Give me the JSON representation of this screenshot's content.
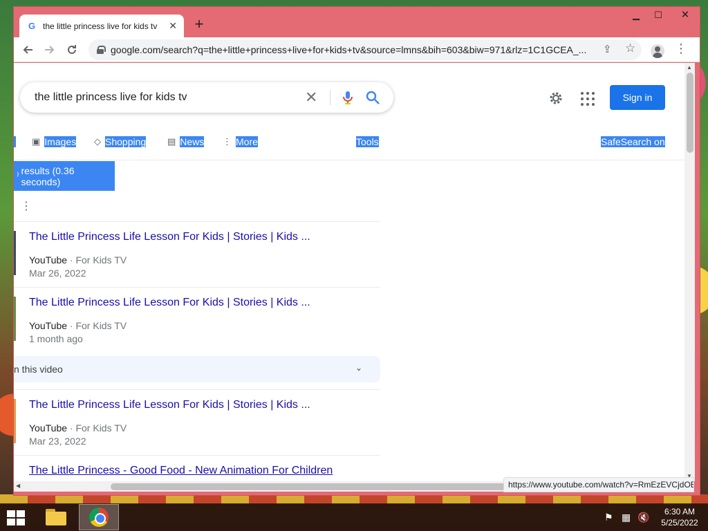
{
  "browser": {
    "tab_title": "the little princess live for kids tv",
    "tab_favicon": "G",
    "new_tab_symbol": "+",
    "url": "google.com/search?q=the+little+princess+live+for+kids+tv&source=lmns&bih=603&biw=971&rlz=1C1GCEA_...",
    "status_url": "https://www.youtube.com/watch?v=RmEzEVCjdOE"
  },
  "search": {
    "query": "the little princess live for kids tv",
    "signin_label": "Sign in"
  },
  "filters": {
    "images": "Images",
    "shopping": "Shopping",
    "news": "News",
    "more": "More",
    "tools": "Tools",
    "safesearch": "SafeSearch on"
  },
  "results_stats": "results (0.36 seconds)",
  "results": [
    {
      "title": "The Little Princess Life Lesson For Kids | Stories | Kids ...",
      "source": "YouTube",
      "channel": "For Kids TV",
      "date": "Mar 26, 2022"
    },
    {
      "title": "The Little Princess Life Lesson For Kids | Stories | Kids ...",
      "source": "YouTube",
      "channel": "For Kids TV",
      "date": "1 month ago"
    },
    {
      "title": "The Little Princess Life Lesson For Kids | Stories | Kids ...",
      "source": "YouTube",
      "channel": "For Kids TV",
      "date": "Mar 23, 2022"
    },
    {
      "title": "The Little Princess - Good Food - New Animation For Children"
    }
  ],
  "video_bar_text": "n this video",
  "separator": " · ",
  "taskbar": {
    "time": "6:30 AM",
    "date": "5/25/2022"
  },
  "colors": {
    "window_frame": "#e46a73",
    "link": "#1a0dab",
    "highlight": "#3b86f2",
    "signin": "#1a73e8"
  }
}
